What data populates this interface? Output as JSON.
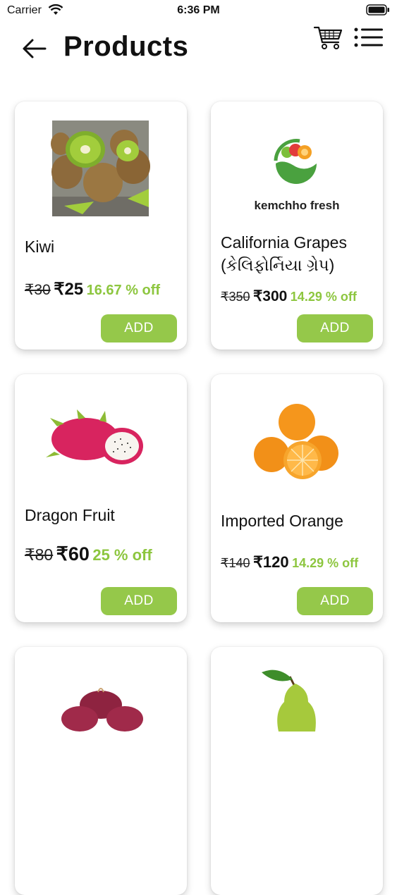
{
  "status_bar": {
    "carrier": "Carrier",
    "time": "6:36 PM"
  },
  "header": {
    "title": "Products"
  },
  "products": [
    {
      "name": "Kiwi",
      "old_price": "₹30",
      "price": "₹25",
      "discount": "16.67 % off",
      "add_label": "ADD",
      "image": "kiwi"
    },
    {
      "name": "California Grapes (કેલિફોર્નિયા ગ્રેપ)",
      "name_line1": "California Grapes",
      "name_line2": "(કેલિફોર્નિયા ગ્રેપ)",
      "old_price": "₹350",
      "price": "₹300",
      "discount": "14.29 % off",
      "add_label": "ADD",
      "image": "kemchho fresh logo",
      "logo_text": "kemchho fresh"
    },
    {
      "name": "Dragon Fruit",
      "old_price": "₹80",
      "price": "₹60",
      "discount": "25 % off",
      "add_label": "ADD",
      "image": "dragon fruit"
    },
    {
      "name": "Imported Orange",
      "old_price": "₹140",
      "price": "₹120",
      "discount": "14.29 % off",
      "add_label": "ADD",
      "image": "oranges"
    },
    {
      "name": "",
      "image": "red onions"
    },
    {
      "name": "",
      "image": "pear"
    }
  ],
  "colors": {
    "accent": "#95c84a",
    "discount": "#8dc63f"
  }
}
